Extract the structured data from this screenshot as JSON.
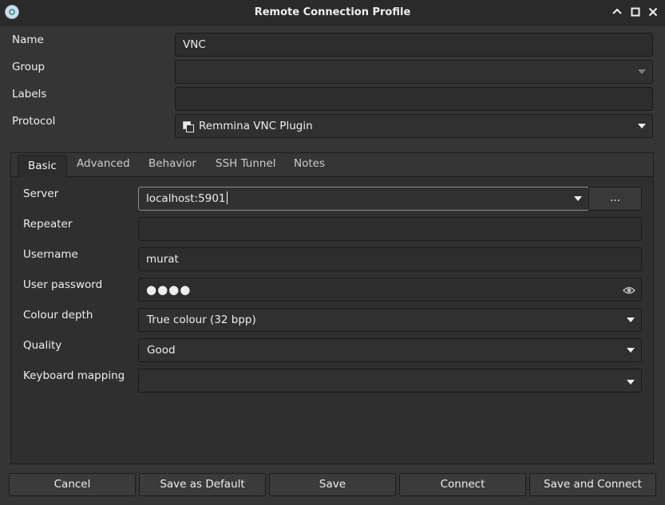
{
  "window": {
    "title": "Remote Connection Profile",
    "icons": [
      "remmina-app-icon",
      "minimize-icon",
      "maximize-icon",
      "close-icon"
    ]
  },
  "profile": {
    "name_label": "Name",
    "name_value": "VNC",
    "group_label": "Group",
    "group_value": "",
    "labels_label": "Labels",
    "labels_value": "",
    "protocol_label": "Protocol",
    "protocol_value": "Remmina VNC Plugin"
  },
  "tabs": [
    {
      "label": "Basic",
      "active": true
    },
    {
      "label": "Advanced",
      "active": false
    },
    {
      "label": "Behavior",
      "active": false
    },
    {
      "label": "SSH Tunnel",
      "active": false
    },
    {
      "label": "Notes",
      "active": false
    }
  ],
  "basic": {
    "server_label": "Server",
    "server_value": "localhost:5901",
    "server_browse_label": "...",
    "repeater_label": "Repeater",
    "repeater_value": "",
    "username_label": "Username",
    "username_value": "murat",
    "password_label": "User password",
    "password_mask": "●●●●",
    "colour_depth_label": "Colour depth",
    "colour_depth_value": "True colour (32 bpp)",
    "quality_label": "Quality",
    "quality_value": "Good",
    "keyboard_label": "Keyboard mapping",
    "keyboard_value": ""
  },
  "buttons": {
    "cancel": "Cancel",
    "save_default": "Save as Default",
    "save": "Save",
    "connect": "Connect",
    "save_connect": "Save and Connect"
  },
  "colors": {
    "background": "#353535",
    "field": "#2d2d2d",
    "text": "#eeeeee",
    "focus_border": "#8e8e8e"
  }
}
